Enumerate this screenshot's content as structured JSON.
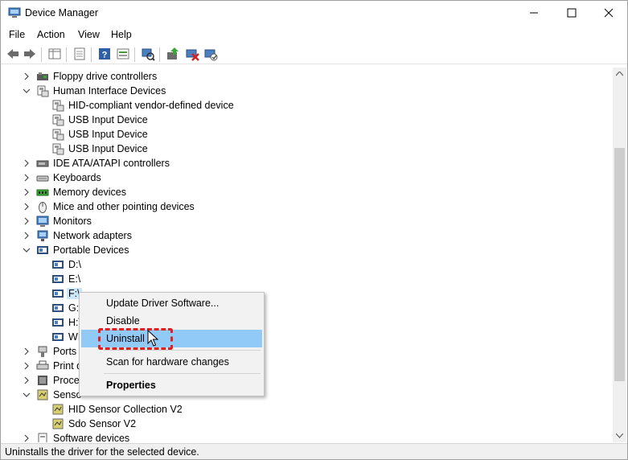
{
  "window": {
    "title": "Device Manager"
  },
  "menu": [
    "File",
    "Action",
    "View",
    "Help"
  ],
  "tree": [
    {
      "label": "Floppy drive controllers",
      "level": 0,
      "expanded": false,
      "icon": "floppy-controller-icon"
    },
    {
      "label": "Human Interface Devices",
      "level": 0,
      "expanded": true,
      "icon": "hid-icon"
    },
    {
      "label": "HID-compliant vendor-defined device",
      "level": 1,
      "icon": "hid-device-icon"
    },
    {
      "label": "USB Input Device",
      "level": 1,
      "icon": "hid-device-icon"
    },
    {
      "label": "USB Input Device",
      "level": 1,
      "icon": "hid-device-icon"
    },
    {
      "label": "USB Input Device",
      "level": 1,
      "icon": "hid-device-icon"
    },
    {
      "label": "IDE ATA/ATAPI controllers",
      "level": 0,
      "expanded": false,
      "icon": "ide-icon"
    },
    {
      "label": "Keyboards",
      "level": 0,
      "expanded": false,
      "icon": "keyboard-icon"
    },
    {
      "label": "Memory devices",
      "level": 0,
      "expanded": false,
      "icon": "memory-icon"
    },
    {
      "label": "Mice and other pointing devices",
      "level": 0,
      "expanded": false,
      "icon": "mouse-icon"
    },
    {
      "label": "Monitors",
      "level": 0,
      "expanded": false,
      "icon": "monitor-icon"
    },
    {
      "label": "Network adapters",
      "level": 0,
      "expanded": false,
      "icon": "network-icon"
    },
    {
      "label": "Portable Devices",
      "level": 0,
      "expanded": true,
      "icon": "portable-icon"
    },
    {
      "label": "D:\\",
      "level": 1,
      "icon": "portable-device-icon"
    },
    {
      "label": "E:\\",
      "level": 1,
      "icon": "portable-device-icon"
    },
    {
      "label": "F:\\",
      "level": 1,
      "icon": "portable-device-icon",
      "selected": true
    },
    {
      "label": "G:\\",
      "level": 1,
      "icon": "portable-device-icon"
    },
    {
      "label": "H:\\",
      "level": 1,
      "icon": "portable-device-icon"
    },
    {
      "label": "WI",
      "level": 1,
      "icon": "portable-device-icon"
    },
    {
      "label": "Ports (",
      "level": 0,
      "expanded": false,
      "icon": "port-icon"
    },
    {
      "label": "Print q",
      "level": 0,
      "expanded": false,
      "icon": "print-icon"
    },
    {
      "label": "Proces",
      "level": 0,
      "expanded": false,
      "icon": "processor-icon"
    },
    {
      "label": "Senso",
      "level": 0,
      "expanded": true,
      "icon": "sensor-icon"
    },
    {
      "label": "HID Sensor Collection V2",
      "level": 1,
      "icon": "sensor-device-icon"
    },
    {
      "label": "Sdo Sensor V2",
      "level": 1,
      "icon": "sensor-device-icon"
    },
    {
      "label": "Software devices",
      "level": 0,
      "expanded": false,
      "icon": "software-icon"
    }
  ],
  "context_menu": {
    "update": "Update Driver Software...",
    "disable": "Disable",
    "uninstall": "Uninstall",
    "scan": "Scan for hardware changes",
    "properties": "Properties"
  },
  "status": "Uninstalls the driver for the selected device.",
  "colors": {
    "highlight": "#91c9f7",
    "annotation": "#e02020",
    "selection": "#cce8ff"
  }
}
